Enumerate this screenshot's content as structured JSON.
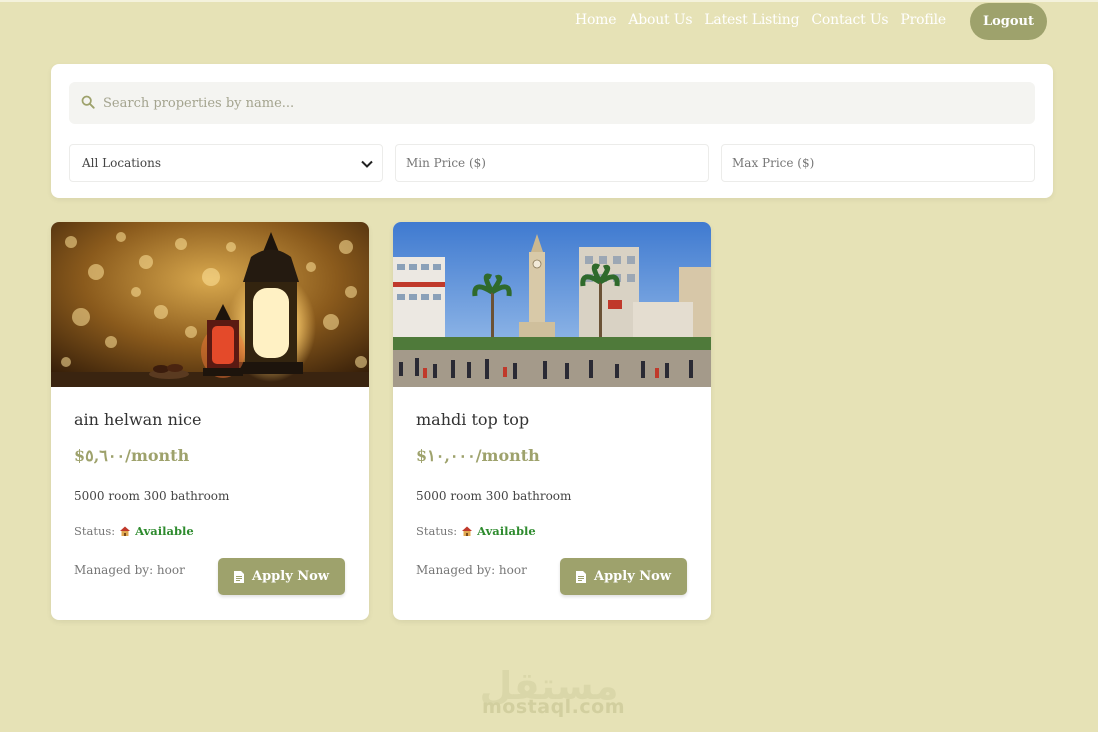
{
  "nav": {
    "links": [
      "Home",
      "About Us",
      "Latest Listing",
      "Contact Us",
      "Profile"
    ],
    "logout_label": "Logout"
  },
  "filters": {
    "search_placeholder": "Search properties by name...",
    "location_selected": "All Locations",
    "min_price_placeholder": "Min Price ($)",
    "max_price_placeholder": "Max Price ($)"
  },
  "listings": [
    {
      "title": "ain helwan nice",
      "price": "$٥,٦٠٠/month",
      "details": "5000 room 300 bathroom",
      "status_label": "Status:",
      "status_value": "Available",
      "manager": "Managed by: hoor",
      "apply_label": "Apply Now"
    },
    {
      "title": "mahdi top top",
      "price": "$١٠,٠٠٠/month",
      "details": "5000 room 300 bathroom",
      "status_label": "Status:",
      "status_value": "Available",
      "manager": "Managed by: hoor",
      "apply_label": "Apply Now"
    }
  ],
  "watermark": {
    "arabic": "مستقل",
    "latin": "mostaql.com"
  },
  "colors": {
    "background": "#e6e2b6",
    "accent": "#9ea26c",
    "available": "#2e8b2e"
  }
}
